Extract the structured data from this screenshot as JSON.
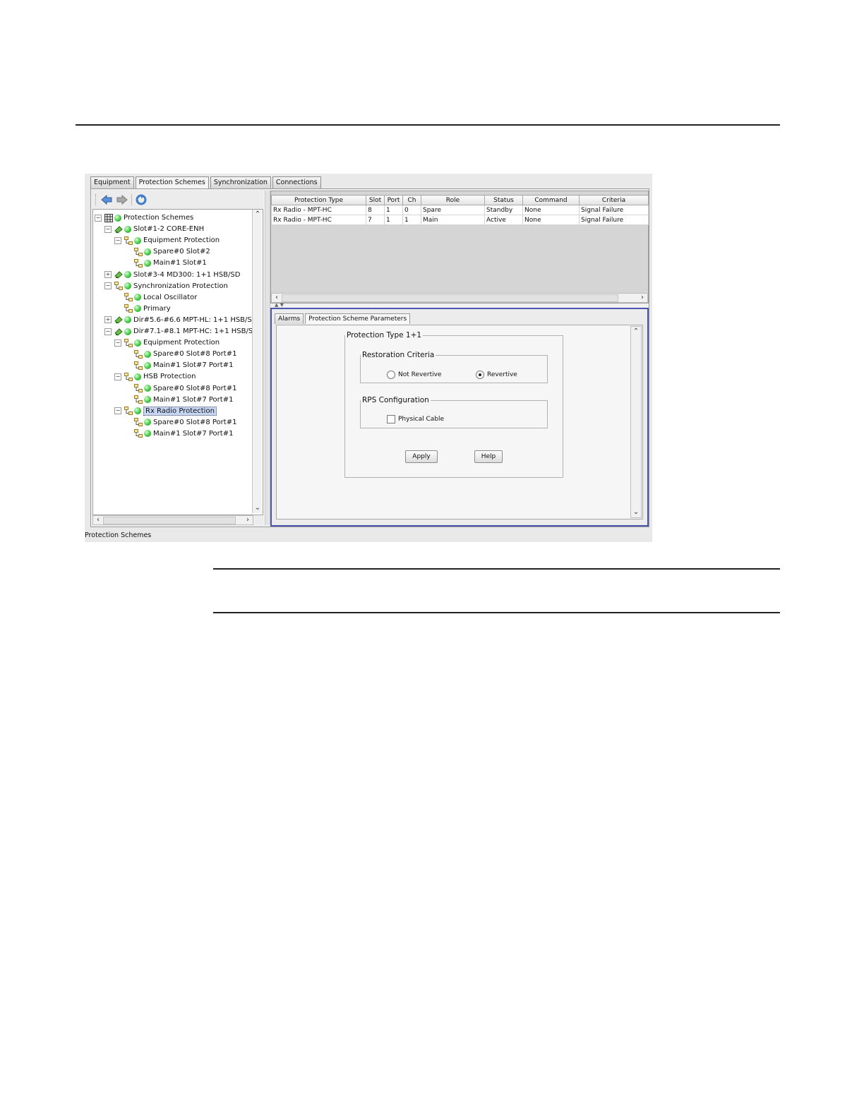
{
  "top_tabs": [
    "Equipment",
    "Protection Schemes",
    "Synchronization",
    "Connections"
  ],
  "active_top_tab": "Protection Schemes",
  "tree": {
    "root": "Protection Schemes",
    "nodes": [
      {
        "label": "Slot#1-2  CORE-ENH"
      },
      {
        "label": "Equipment Protection"
      },
      {
        "label": "Spare#0 Slot#2"
      },
      {
        "label": "Main#1 Slot#1"
      },
      {
        "label": "Slot#3-4  MD300: 1+1 HSB/SD"
      },
      {
        "label": "Synchronization Protection"
      },
      {
        "label": "Local Oscillator"
      },
      {
        "label": "Primary"
      },
      {
        "label": "Dir#5.6-#6.6  MPT-HL: 1+1 HSB/S"
      },
      {
        "label": "Dir#7.1-#8.1  MPT-HC: 1+1 HSB/S"
      },
      {
        "label": "Equipment Protection"
      },
      {
        "label": "Spare#0 Slot#8 Port#1"
      },
      {
        "label": "Main#1 Slot#7 Port#1"
      },
      {
        "label": "HSB Protection"
      },
      {
        "label": "Spare#0 Slot#8 Port#1"
      },
      {
        "label": "Main#1 Slot#7 Port#1"
      },
      {
        "label": "Rx Radio Protection"
      },
      {
        "label": "Spare#0 Slot#8 Port#1"
      },
      {
        "label": "Main#1 Slot#7 Port#1"
      }
    ],
    "selected": "Rx Radio Protection"
  },
  "table": {
    "columns": [
      "Protection Type",
      "Slot",
      "Port",
      "Ch",
      "Role",
      "Status",
      "Command",
      "Criteria"
    ],
    "rows": [
      [
        "Rx Radio - MPT-HC",
        "8",
        "1",
        "0",
        "Spare",
        "Standby",
        "None",
        "Signal Failure"
      ],
      [
        "Rx Radio - MPT-HC",
        "7",
        "1",
        "1",
        "Main",
        "Active",
        "None",
        "Signal Failure"
      ]
    ]
  },
  "inner_tabs": [
    "Alarms",
    "Protection Scheme Parameters"
  ],
  "active_inner_tab": "Protection Scheme Parameters",
  "params": {
    "group_title": "Protection Type 1+1",
    "restoration": {
      "title": "Restoration Criteria",
      "options": [
        "Not Revertive",
        "Revertive"
      ],
      "selected": "Revertive"
    },
    "rps": {
      "title": "RPS Configuration",
      "checkbox_label": "Physical Cable",
      "checked": false
    },
    "apply_label": "Apply",
    "help_label": "Help"
  },
  "status_bar": "Protection Schemes",
  "colors": {
    "status_ok": "#39c23a",
    "selection": "#c8d6f5",
    "panel_border": "#4a55b0"
  },
  "icons": [
    "back-arrow-icon",
    "forward-arrow-icon",
    "refresh-icon",
    "grid-icon",
    "card-icon",
    "hierarchy-icon",
    "status-green-icon"
  ]
}
